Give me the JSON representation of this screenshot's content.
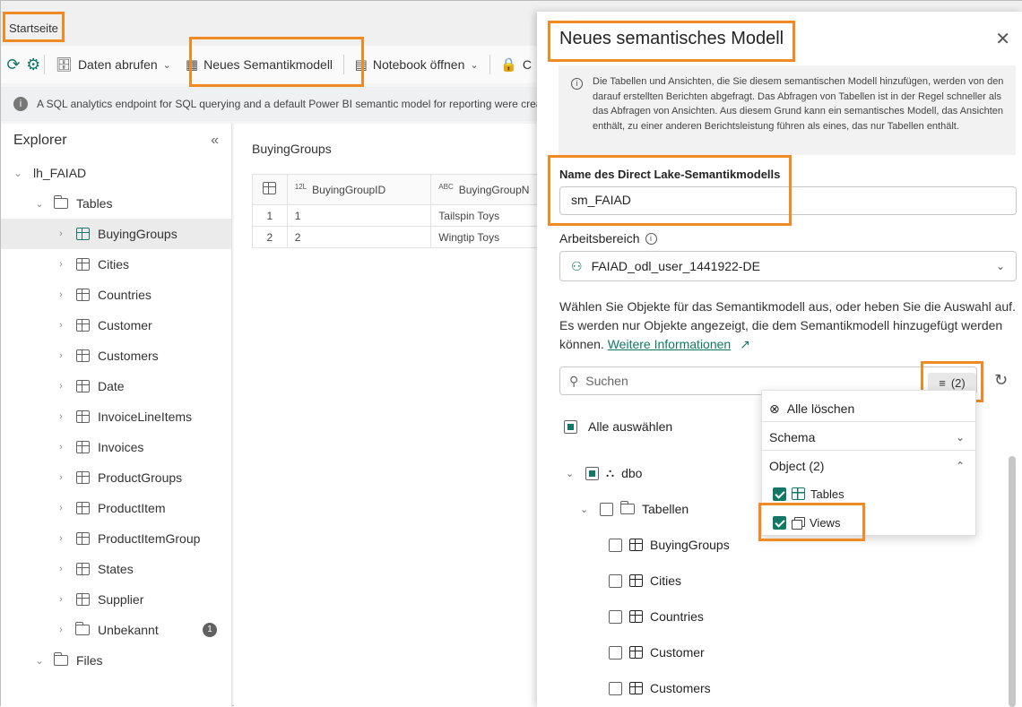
{
  "topbar": {
    "home_tab": "Startseite"
  },
  "toolbar": {
    "get_data": "Daten abrufen",
    "new_semantic_model": "Neues Semantikmodell",
    "open_notebook": "Notebook öffnen",
    "truncated_next": "C"
  },
  "banner": {
    "text": "A SQL analytics endpoint for SQL querying and a default Power BI semantic model for reporting were crea"
  },
  "explorer": {
    "title": "Explorer",
    "lakehouse": "lh_FAIAD",
    "tables_folder": "Tables",
    "tables": [
      {
        "label": "BuyingGroups"
      },
      {
        "label": "Cities"
      },
      {
        "label": "Countries"
      },
      {
        "label": "Customer"
      },
      {
        "label": "Customers"
      },
      {
        "label": "Date"
      },
      {
        "label": "InvoiceLineItems"
      },
      {
        "label": "Invoices"
      },
      {
        "label": "ProductGroups"
      },
      {
        "label": "ProductItem"
      },
      {
        "label": "ProductItemGroup"
      },
      {
        "label": "States"
      },
      {
        "label": "Supplier"
      }
    ],
    "unknown_folder": "Unbekannt",
    "unknown_badge": "1",
    "files_folder": "Files"
  },
  "preview": {
    "title": "BuyingGroups",
    "columns": [
      {
        "type": "12L",
        "name": "BuyingGroupID"
      },
      {
        "type": "ABC",
        "name": "BuyingGroupN"
      }
    ],
    "rows": [
      {
        "num": "1",
        "id": "1",
        "name": "Tailspin Toys"
      },
      {
        "num": "2",
        "id": "2",
        "name": "Wingtip Toys"
      }
    ]
  },
  "panel": {
    "title": "Neues semantisches Modell",
    "info": "Die Tabellen und Ansichten, die Sie diesem semantischen Modell hinzufügen, werden von den darauf erstellten Berichten abgefragt. Das Abfragen von Tabellen ist in der Regel schneller als das Abfragen von Ansichten. Aus diesem Grund kann ein semantisches Modell, das Ansichten enthält, zu einer anderen Berichtsleistung führen als eines, das nur Tabellen enthält.",
    "name_label": "Name des Direct Lake-Semantikmodells",
    "name_value": "sm_FAIAD",
    "workspace_label": "Arbeitsbereich",
    "workspace_value": "FAIAD_odl_user_1441922-DE",
    "description": "Wählen Sie Objekte für das Semantikmodell aus, oder heben Sie die Auswahl auf. Es werden nur Objekte angezeigt, die dem Semantikmodell hinzugefügt werden können.",
    "more_info_link": "Weitere Informationen",
    "search_placeholder": "Suchen",
    "filter_count": "(2)",
    "select_all": "Alle auswählen",
    "schema_node": "dbo",
    "tables_node": "Tabellen",
    "tables": [
      "BuyingGroups",
      "Cities",
      "Countries",
      "Customer",
      "Customers"
    ]
  },
  "filter_menu": {
    "clear_all": "Alle löschen",
    "schema": "Schema",
    "object": "Object (2)",
    "tables_option": "Tables",
    "views_option": "Views"
  },
  "colors": {
    "accent": "#117865",
    "highlight": "#f08a24"
  }
}
